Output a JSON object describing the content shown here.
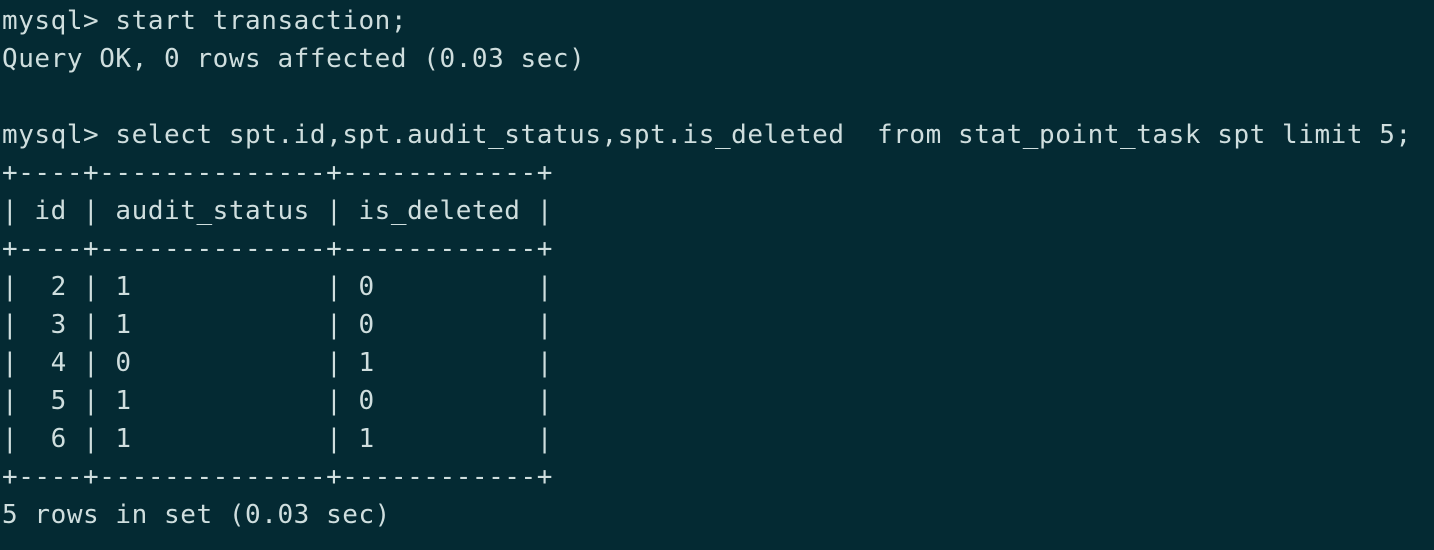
{
  "terminal": {
    "title": "mysql-client-terminal",
    "colors": {
      "background": "#042a33",
      "foreground": "#cfdede"
    },
    "prompt": "mysql>",
    "lines": [
      "mysql> start transaction;",
      "Query OK, 0 rows affected (0.03 sec)",
      "",
      "mysql> select spt.id,spt.audit_status,spt.is_deleted  from stat_point_task spt limit 5;",
      "+----+--------------+------------+",
      "| id | audit_status | is_deleted |",
      "+----+--------------+------------+",
      "|  2 | 1            | 0          |",
      "|  3 | 1            | 0          |",
      "|  4 | 0            | 1          |",
      "|  5 | 1            | 0          |",
      "|  6 | 1            | 1          |",
      "+----+--------------+------------+",
      "5 rows in set (0.03 sec)"
    ],
    "commands": [
      {
        "prompt": "mysql>",
        "sql": "start transaction;",
        "result": "Query OK, 0 rows affected (0.03 sec)"
      },
      {
        "prompt": "mysql>",
        "sql": "select spt.id,spt.audit_status,spt.is_deleted  from stat_point_task spt limit 5;",
        "result": "5 rows in set (0.03 sec)"
      }
    ],
    "result_table": {
      "columns": [
        "id",
        "audit_status",
        "is_deleted"
      ],
      "rows": [
        [
          "2",
          "1",
          "0"
        ],
        [
          "3",
          "1",
          "0"
        ],
        [
          "4",
          "0",
          "1"
        ],
        [
          "5",
          "1",
          "0"
        ],
        [
          "6",
          "1",
          "1"
        ]
      ],
      "separator": "+----+--------------+------------+",
      "row_count_label": "5 rows in set (0.03 sec)"
    }
  }
}
